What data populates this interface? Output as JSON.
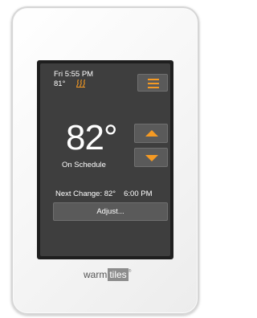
{
  "status_bar": {
    "clock": "Fri 5:55 PM",
    "room_temp": "81°",
    "heating_icon": "heat-waves-icon"
  },
  "menu_button": {
    "icon": "hamburger-menu-icon"
  },
  "setpoint": {
    "temperature": "82°",
    "mode": "On Schedule",
    "up_icon": "arrow-up-icon",
    "down_icon": "arrow-down-icon"
  },
  "schedule": {
    "next_change_label": "Next Change: 82°",
    "next_change_time": "6:00 PM"
  },
  "adjust_button": {
    "label": "Adjust..."
  },
  "brand": {
    "part1": "warm",
    "part2": "tiles",
    "reg": "®"
  },
  "colors": {
    "accent": "#f59a23",
    "screen": "#3e3e3e",
    "button": "#5a5a5a",
    "bezel": "#1e1e1e"
  }
}
